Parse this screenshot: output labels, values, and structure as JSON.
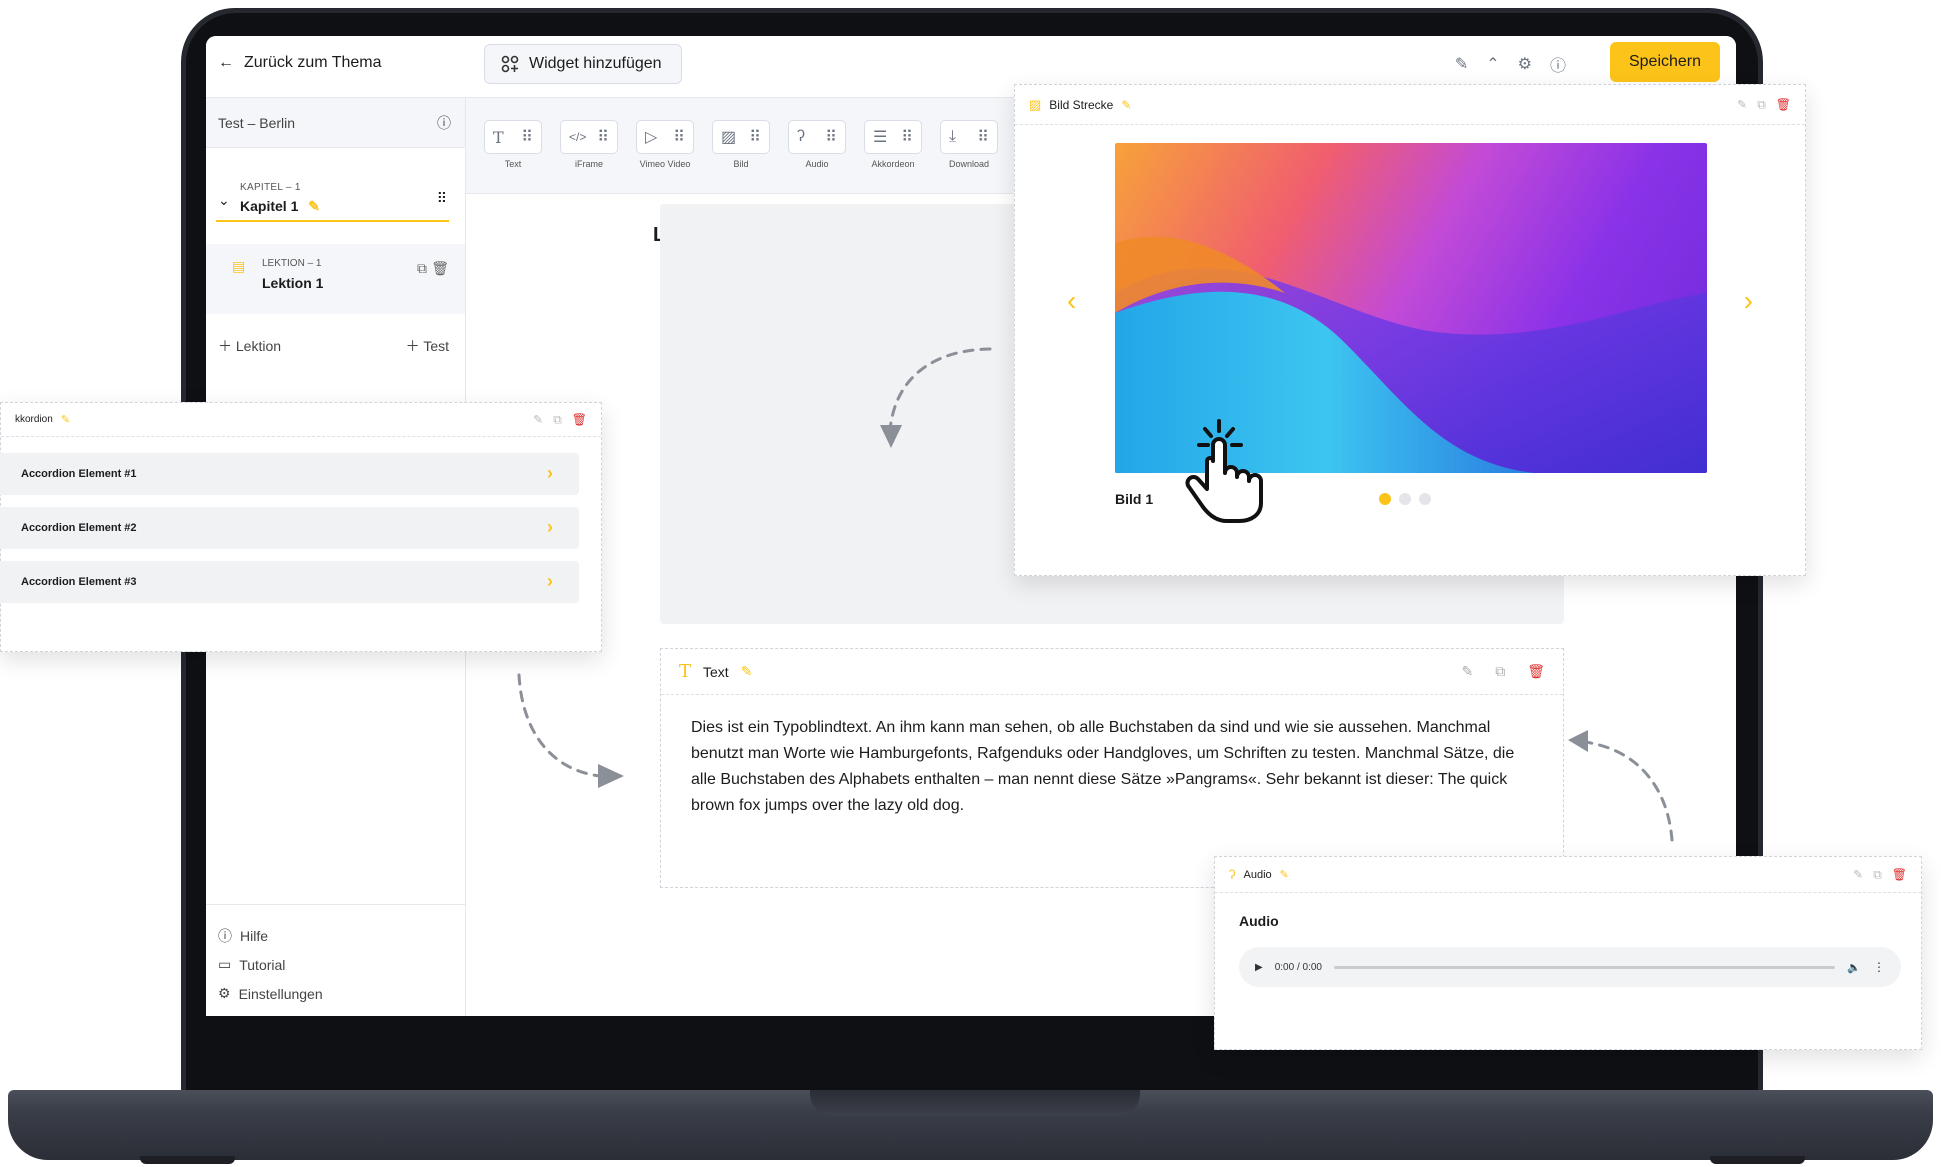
{
  "header": {
    "back_label": "Zurück zum Thema",
    "add_widget_label": "Widget hinzufügen",
    "save_label": "Speichern"
  },
  "sidebar": {
    "project_title": "Test – Berlin",
    "chapter": {
      "caption": "KAPITEL – 1",
      "title": "Kapitel 1"
    },
    "lesson": {
      "caption": "LEKTION – 1",
      "title": "Lektion 1"
    },
    "add_lesson": "Lektion",
    "add_test": "Test",
    "bottom": {
      "help": "Hilfe",
      "tutorial": "Tutorial",
      "settings": "Einstellungen"
    }
  },
  "widgets": [
    {
      "label": "Text",
      "icon": "text-icon"
    },
    {
      "label": "iFrame",
      "icon": "code-icon"
    },
    {
      "label": "Vimeo Video",
      "icon": "video-icon"
    },
    {
      "label": "Bild",
      "icon": "image-icon"
    },
    {
      "label": "Audio",
      "icon": "ear-icon"
    },
    {
      "label": "Akkordeon",
      "icon": "list-icon"
    },
    {
      "label": "Download",
      "icon": "download-icon"
    }
  ],
  "canvas": {
    "partial_letter": "L"
  },
  "text_widget": {
    "title": "Text",
    "body": "Dies ist ein Typoblindtext. An ihm kann man sehen, ob alle Buchstaben da sind und wie sie aussehen. Manchmal benutzt man Worte wie Hamburgefonts, Rafgenduks oder Handgloves, um Schriften zu testen. Manchmal Sätze, die alle Buchstaben des Alphabets enthalten – man nennt diese Sätze »Pangrams«. Sehr bekannt ist dieser: The quick brown fox jumps over the lazy old dog."
  },
  "accordion_widget": {
    "title": "kkordion",
    "items": [
      "Accordion Element #1",
      "Accordion Element #2",
      "Accordion Element #3"
    ]
  },
  "bild_widget": {
    "title": "Bild Strecke",
    "caption": "Bild 1",
    "slide_count": 3,
    "active_slide": 1
  },
  "audio_widget": {
    "title": "Audio",
    "heading": "Audio",
    "time": "0:00 / 0:00"
  },
  "colors": {
    "accent": "#fcc419",
    "danger": "#e03131",
    "muted": "#6b7280"
  }
}
